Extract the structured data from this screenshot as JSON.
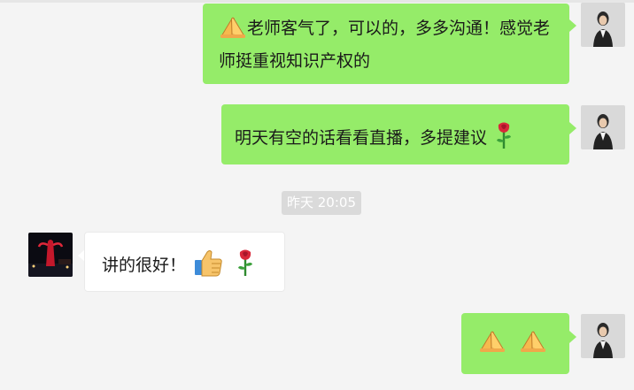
{
  "chat": {
    "messages": [
      {
        "sender": "me",
        "text": "老师客气了，可以的，多多沟通！感觉老师挺重视知识产权的",
        "emoji_before": "folded-hands-emoji"
      },
      {
        "sender": "me",
        "text": "明天有空的话看看直播，多提建议",
        "emoji_after": "rose-emoji"
      },
      {
        "sender": "other",
        "text": "讲的很好！",
        "emoji_after": [
          "thumbs-up-emoji",
          "rose-emoji"
        ]
      },
      {
        "sender": "me",
        "text": "",
        "emoji": [
          "folded-hands-emoji",
          "folded-hands-emoji"
        ]
      }
    ],
    "timestamp": "昨天 20:05"
  },
  "colors": {
    "background": "#f4f4f4",
    "my_bubble": "#95ec69",
    "their_bubble": "#ffffff",
    "timestamp_bg": "#dadada"
  }
}
